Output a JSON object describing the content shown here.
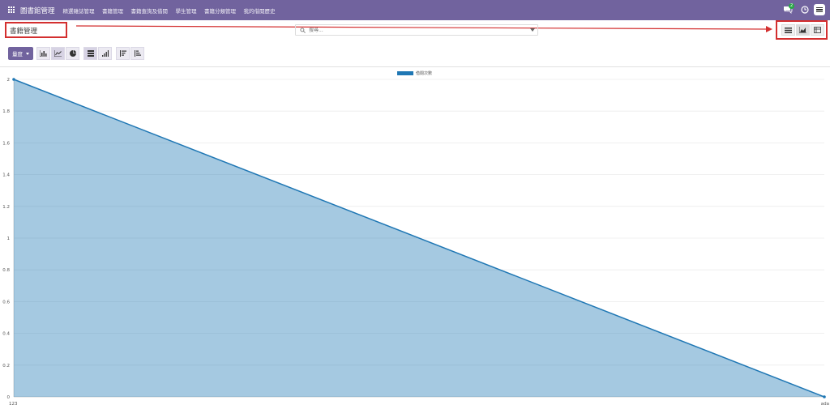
{
  "navbar": {
    "brand": "圖書館管理",
    "menu": [
      "精選雜誌管理",
      "書籍管理",
      "書籍查詢及借閱",
      "學生管理",
      "書籍分類管理",
      "我的借閱歷史"
    ],
    "chat_badge": "2",
    "bg_color": "#71639e"
  },
  "control": {
    "breadcrumb": "書籍管理",
    "search_placeholder": "搜尋...",
    "measures_label": "量度",
    "views": [
      "list-view-icon",
      "graph-view-icon",
      "pivot-view-icon"
    ],
    "active_view": "graph",
    "highlight_color": "#d32f2f"
  },
  "chart_data": {
    "type": "area",
    "categories": [
      "123",
      "ada"
    ],
    "series": [
      {
        "name": "借閱次數",
        "values": [
          2,
          0
        ],
        "color": "#1f77b4"
      }
    ],
    "yticks": [
      0,
      0.2,
      0.4,
      0.6,
      0.8,
      1,
      1.2,
      1.4,
      1.6,
      1.8,
      2
    ],
    "ylim": [
      0,
      2
    ],
    "legend_position": "top-center",
    "grid": true
  }
}
